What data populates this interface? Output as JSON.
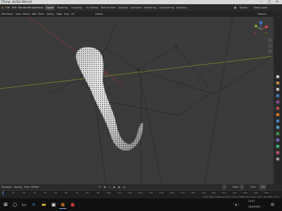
{
  "window": {
    "title": "[Temp: sfx1bt (Blend)"
  },
  "menu": [
    "File",
    "Edit",
    "Render",
    "Window",
    "Help"
  ],
  "workspaces": [
    "Layout",
    "Modeling",
    "Sculpting",
    "UV Editing",
    "Texture Paint",
    "Shading",
    "Animation",
    "Rendering",
    "Compositing",
    "Scripting"
  ],
  "active_workspace": "Layout",
  "scene": {
    "label": "Scene",
    "layer": "View Layer"
  },
  "viewport_header": {
    "mode": "Edit Mode",
    "view": "View",
    "select": "Select",
    "add": "Add",
    "mesh": "Mesh",
    "vertex": "Vertex",
    "edge": "Edge",
    "face": "Face",
    "uv": "UV",
    "transform_orientation": "Global",
    "overlays": "Options"
  },
  "timeline": {
    "playback": "Playback",
    "keying": "Keying",
    "view": "View",
    "marker": "Marker",
    "current_frame": "1",
    "start_label": "Start",
    "start": "1",
    "end_label": "End",
    "end": "250"
  },
  "ruler_ticks": [
    "0",
    "10",
    "20",
    "30",
    "40",
    "50",
    "60",
    "70",
    "80",
    "90",
    "100",
    "110",
    "120",
    "130",
    "140",
    "150",
    "160",
    "170",
    "180",
    "190",
    "200",
    "210",
    "220",
    "230",
    "240",
    "250"
  ],
  "status": {
    "text": "Verts 0/961 | Edges 0/1,920 | Faces 0/960 | Tris 1,920 | Mem: 42.1 MB | v2.81"
  },
  "taskbar": {
    "time": "11:47",
    "date": "12/3/2019"
  },
  "colors": {
    "x_axis": "#8c3a3a",
    "y_axis": "#7b8c2d",
    "accent": "#e07b1f"
  }
}
